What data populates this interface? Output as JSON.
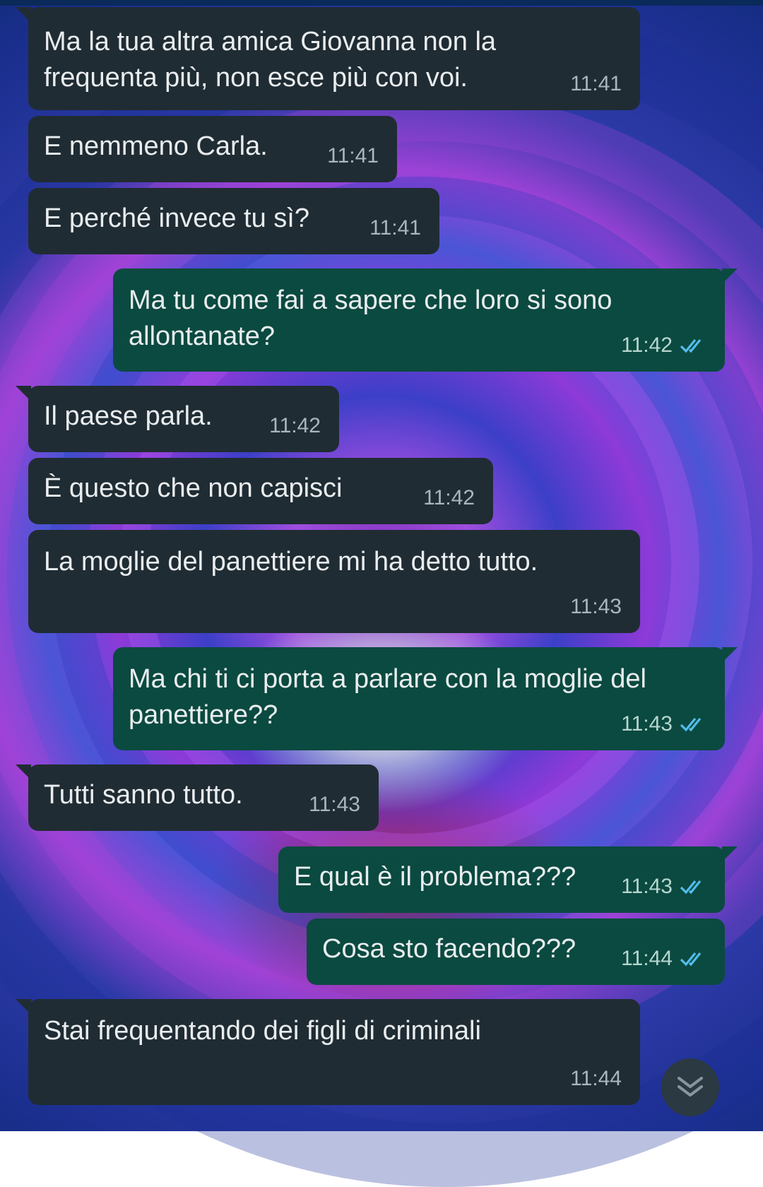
{
  "colors": {
    "incoming_bubble": "#202c33",
    "outgoing_bubble": "#0b4a40",
    "text": "#e9edef",
    "read_ticks": "#53bdeb"
  },
  "messages": [
    {
      "direction": "in",
      "text": "Ma la tua altra amica Giovanna non la frequenta più, non esce più con voi.",
      "time": "11:41"
    },
    {
      "direction": "in",
      "text": "E nemmeno Carla.",
      "time": "11:41"
    },
    {
      "direction": "in",
      "text": "E perché invece tu sì?",
      "time": "11:41"
    },
    {
      "direction": "out",
      "text": "Ma tu come fai a sapere che loro si sono allontanate?",
      "time": "11:42",
      "status": "read-ticks-icon"
    },
    {
      "direction": "in",
      "text": "Il paese parla.",
      "time": "11:42"
    },
    {
      "direction": "in",
      "text": "È questo che non capisci",
      "time": "11:42"
    },
    {
      "direction": "in",
      "text": "La moglie del panettiere mi ha detto tutto.",
      "time": "11:43"
    },
    {
      "direction": "out",
      "text": "Ma chi ti ci porta a parlare con la moglie del panettiere??",
      "time": "11:43",
      "status": "read-ticks-icon"
    },
    {
      "direction": "in",
      "text": "Tutti sanno tutto.",
      "time": "11:43"
    },
    {
      "direction": "out",
      "text": "E qual è il problema???",
      "time": "11:43",
      "status": "read-ticks-icon"
    },
    {
      "direction": "out",
      "text": "Cosa sto facendo???",
      "time": "11:44",
      "status": "read-ticks-icon"
    },
    {
      "direction": "in",
      "text": "Stai frequentando dei figli di criminali",
      "time": "11:44"
    }
  ],
  "scroll_to_bottom": {
    "icon": "chevron-double-down-icon"
  }
}
